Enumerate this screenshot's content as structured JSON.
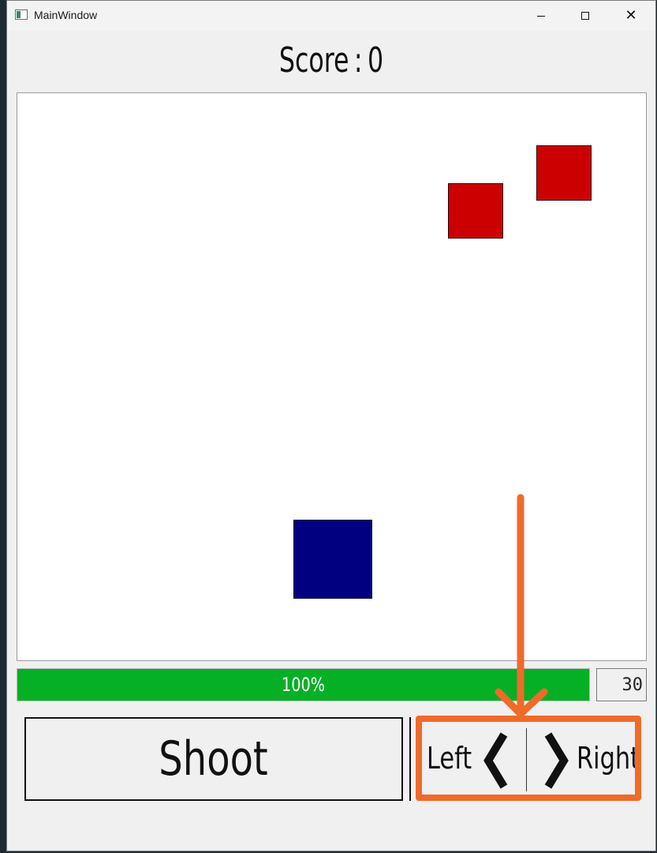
{
  "window": {
    "title": "MainWindow"
  },
  "score": {
    "label": "Score",
    "separator": ":",
    "value": "0"
  },
  "game": {
    "enemies": 2,
    "enemy_color": "#cc0000",
    "player_color": "#000080"
  },
  "progress": {
    "value_percent": 100,
    "text": "100%",
    "color": "#06b025"
  },
  "counter": {
    "value": "30"
  },
  "controls": {
    "shoot_label": "Shoot",
    "left_label": "Left",
    "right_label": "Right"
  },
  "annotation": {
    "color": "#f06a2a"
  }
}
